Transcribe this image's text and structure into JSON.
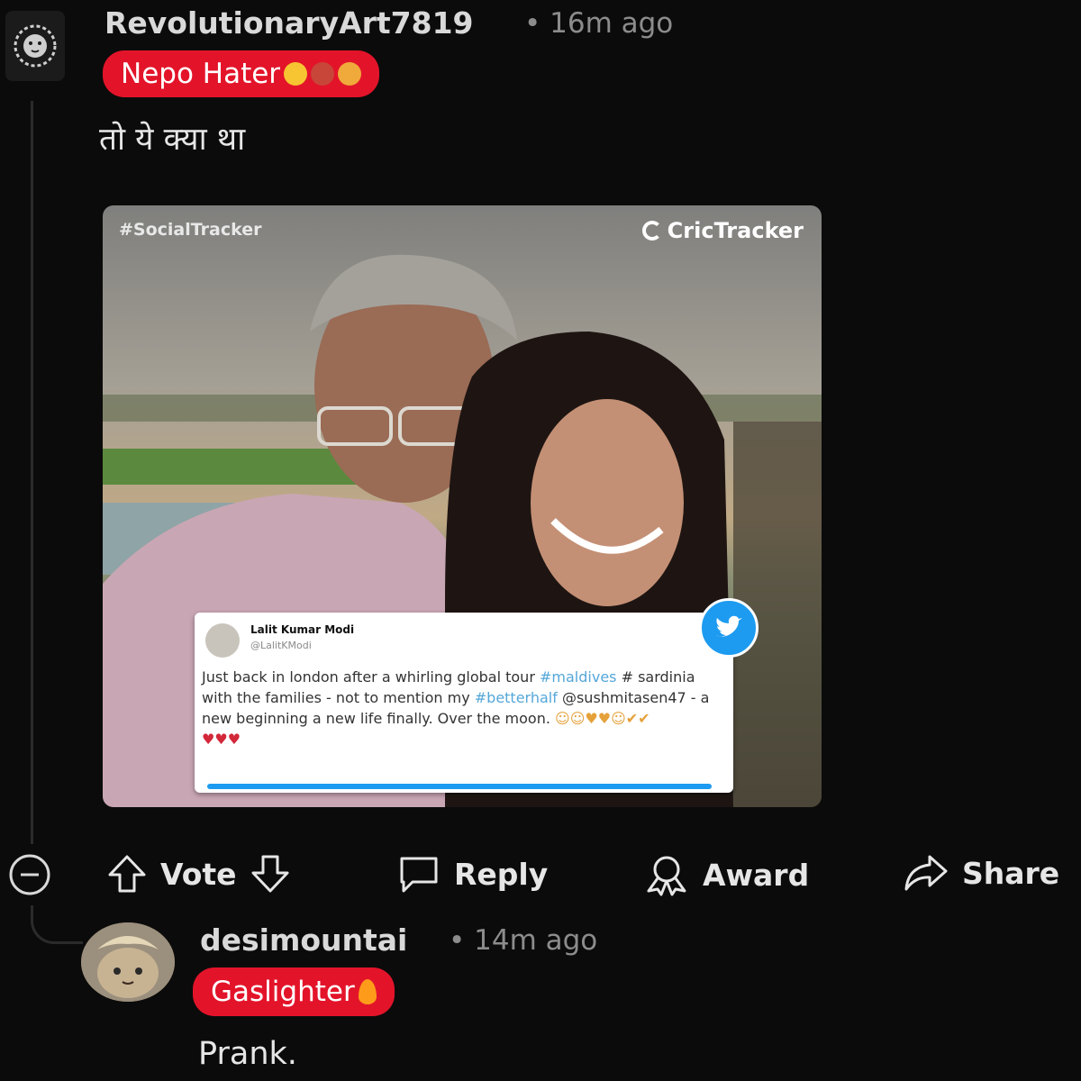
{
  "comment": {
    "username": "RevolutionaryArt7819",
    "time": "• 16m ago",
    "flair": "Nepo Hater",
    "body": "तो ये क्या था"
  },
  "media": {
    "tag": "#SocialTracker",
    "brand": "CricTracker",
    "tweet": {
      "name": "Lalit Kumar Modi",
      "handle": "@LalitKModi",
      "text_1": "Just back in london after a whirling global tour",
      "hashtag_1": "#maldives",
      "text_2": "# sardinia with the families - not to mention my",
      "hashtag_2": "#betterhalf",
      "text_3": "@sushmitasen47 - a new beginning a new life finally. Over the moon."
    }
  },
  "actions": {
    "vote": "Vote",
    "reply": "Reply",
    "award": "Award",
    "share": "Share"
  },
  "reply": {
    "username": "desimountai",
    "time": "• 14m ago",
    "flair": "Gaslighter",
    "body": "Prank."
  },
  "colors": {
    "background": "#0b0b0b",
    "flair": "#e3142a",
    "twitter_blue": "#1d9bf0"
  }
}
